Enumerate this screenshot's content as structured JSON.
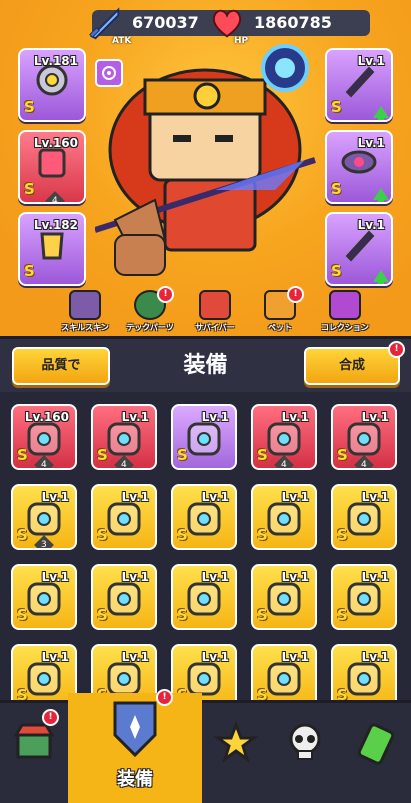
{
  "stats": {
    "atk": {
      "label": "ATK",
      "value": "670037"
    },
    "hp": {
      "label": "HP",
      "value": "1860785"
    }
  },
  "left_slots": [
    {
      "level": "Lv.181",
      "grade": "S",
      "color": "purple",
      "icon": "gear-icon"
    },
    {
      "level": "Lv.160",
      "grade": "S",
      "color": "red",
      "icon": "chest-armor-icon",
      "stars": "4"
    },
    {
      "level": "Lv.182",
      "grade": "S",
      "color": "purple",
      "icon": "gauntlet-icon"
    }
  ],
  "right_slots": [
    {
      "level": "Lv.1",
      "grade": "S",
      "color": "purple",
      "icon": "sword-icon",
      "upgrade": true
    },
    {
      "level": "Lv.1",
      "grade": "S",
      "color": "purple",
      "icon": "belt-icon",
      "upgrade": true
    },
    {
      "level": "Lv.1",
      "grade": "S",
      "color": "purple",
      "icon": "sword-icon",
      "upgrade": true
    }
  ],
  "tabs": [
    {
      "label": "スキルスキン",
      "icon": "hat-icon",
      "color": "#7c5ca8",
      "alert": false
    },
    {
      "label": "テックパーツ",
      "icon": "hexagon-icon",
      "color": "#3a8a4b",
      "alert": true
    },
    {
      "label": "サバイバー",
      "icon": "survivor-icon",
      "color": "#e04a3a",
      "alert": false
    },
    {
      "label": "ペット",
      "icon": "pet-icon",
      "color": "#f0a030",
      "alert": true
    },
    {
      "label": "コレクション",
      "icon": "chest-icon",
      "color": "#b04ad0",
      "alert": false
    }
  ],
  "toolbar": {
    "sort_label": "品質で",
    "title": "装備",
    "merge_label": "合成"
  },
  "grid": [
    [
      {
        "level": "Lv.160",
        "grade": "S",
        "color": "red",
        "icon": "chest-armor-icon",
        "stars": "4"
      },
      {
        "level": "Lv.1",
        "grade": "S",
        "color": "red",
        "icon": "belt-icon",
        "stars": "4"
      },
      {
        "level": "Lv.1",
        "grade": "S",
        "color": "purple",
        "icon": "necklace-icon",
        "stars": ""
      },
      {
        "level": "Lv.1",
        "grade": "S",
        "color": "red",
        "icon": "armor-icon",
        "stars": "4"
      },
      {
        "level": "Lv.1",
        "grade": "S",
        "color": "red",
        "icon": "gauntlet-icon",
        "stars": "4"
      }
    ],
    [
      {
        "level": "Lv.1",
        "grade": "S",
        "color": "yellow",
        "icon": "belt-icon",
        "stars": "3"
      },
      {
        "level": "Lv.1",
        "grade": "S",
        "color": "yellow",
        "icon": "sword-icon",
        "stars": ""
      },
      {
        "level": "Lv.1",
        "grade": "S",
        "color": "yellow",
        "icon": "sword-icon",
        "stars": ""
      },
      {
        "level": "Lv.1",
        "grade": "S",
        "color": "yellow",
        "icon": "sword-icon",
        "stars": ""
      },
      {
        "level": "Lv.1",
        "grade": "S",
        "color": "yellow",
        "icon": "staff-icon",
        "stars": ""
      }
    ],
    [
      {
        "level": "Lv.1",
        "grade": "S",
        "color": "yellow",
        "icon": "armor-icon",
        "stars": ""
      },
      {
        "level": "Lv.1",
        "grade": "S",
        "color": "yellow",
        "icon": "armor-icon",
        "stars": ""
      },
      {
        "level": "Lv.1",
        "grade": "S",
        "color": "yellow",
        "icon": "necklace-icon",
        "stars": ""
      },
      {
        "level": "Lv.1",
        "grade": "S",
        "color": "yellow",
        "icon": "necklace-icon",
        "stars": ""
      },
      {
        "level": "Lv.1",
        "grade": "S",
        "color": "yellow",
        "icon": "necklace-icon",
        "stars": ""
      }
    ],
    [
      {
        "level": "Lv.1",
        "grade": "S",
        "color": "yellow",
        "icon": "necklace-icon",
        "stars": ""
      },
      {
        "level": "Lv.1",
        "grade": "S",
        "color": "yellow",
        "icon": "belt-icon",
        "stars": ""
      },
      {
        "level": "Lv.1",
        "grade": "S",
        "color": "yellow",
        "icon": "belt-icon",
        "stars": ""
      },
      {
        "level": "Lv.1",
        "grade": "S",
        "color": "yellow",
        "icon": "belt-icon",
        "stars": ""
      },
      {
        "level": "Lv.1",
        "grade": "S",
        "color": "yellow",
        "icon": "belt-icon",
        "stars": ""
      }
    ]
  ],
  "bottom_nav": [
    {
      "icon": "shop-icon",
      "label": "",
      "alert": true
    },
    {
      "icon": "equipment-icon",
      "label": "装備",
      "alert": true,
      "active": true
    },
    {
      "icon": "star-battle-icon",
      "label": "",
      "alert": false
    },
    {
      "icon": "skull-icon",
      "label": "",
      "alert": false
    },
    {
      "icon": "battery-icon",
      "label": "",
      "alert": false
    }
  ]
}
